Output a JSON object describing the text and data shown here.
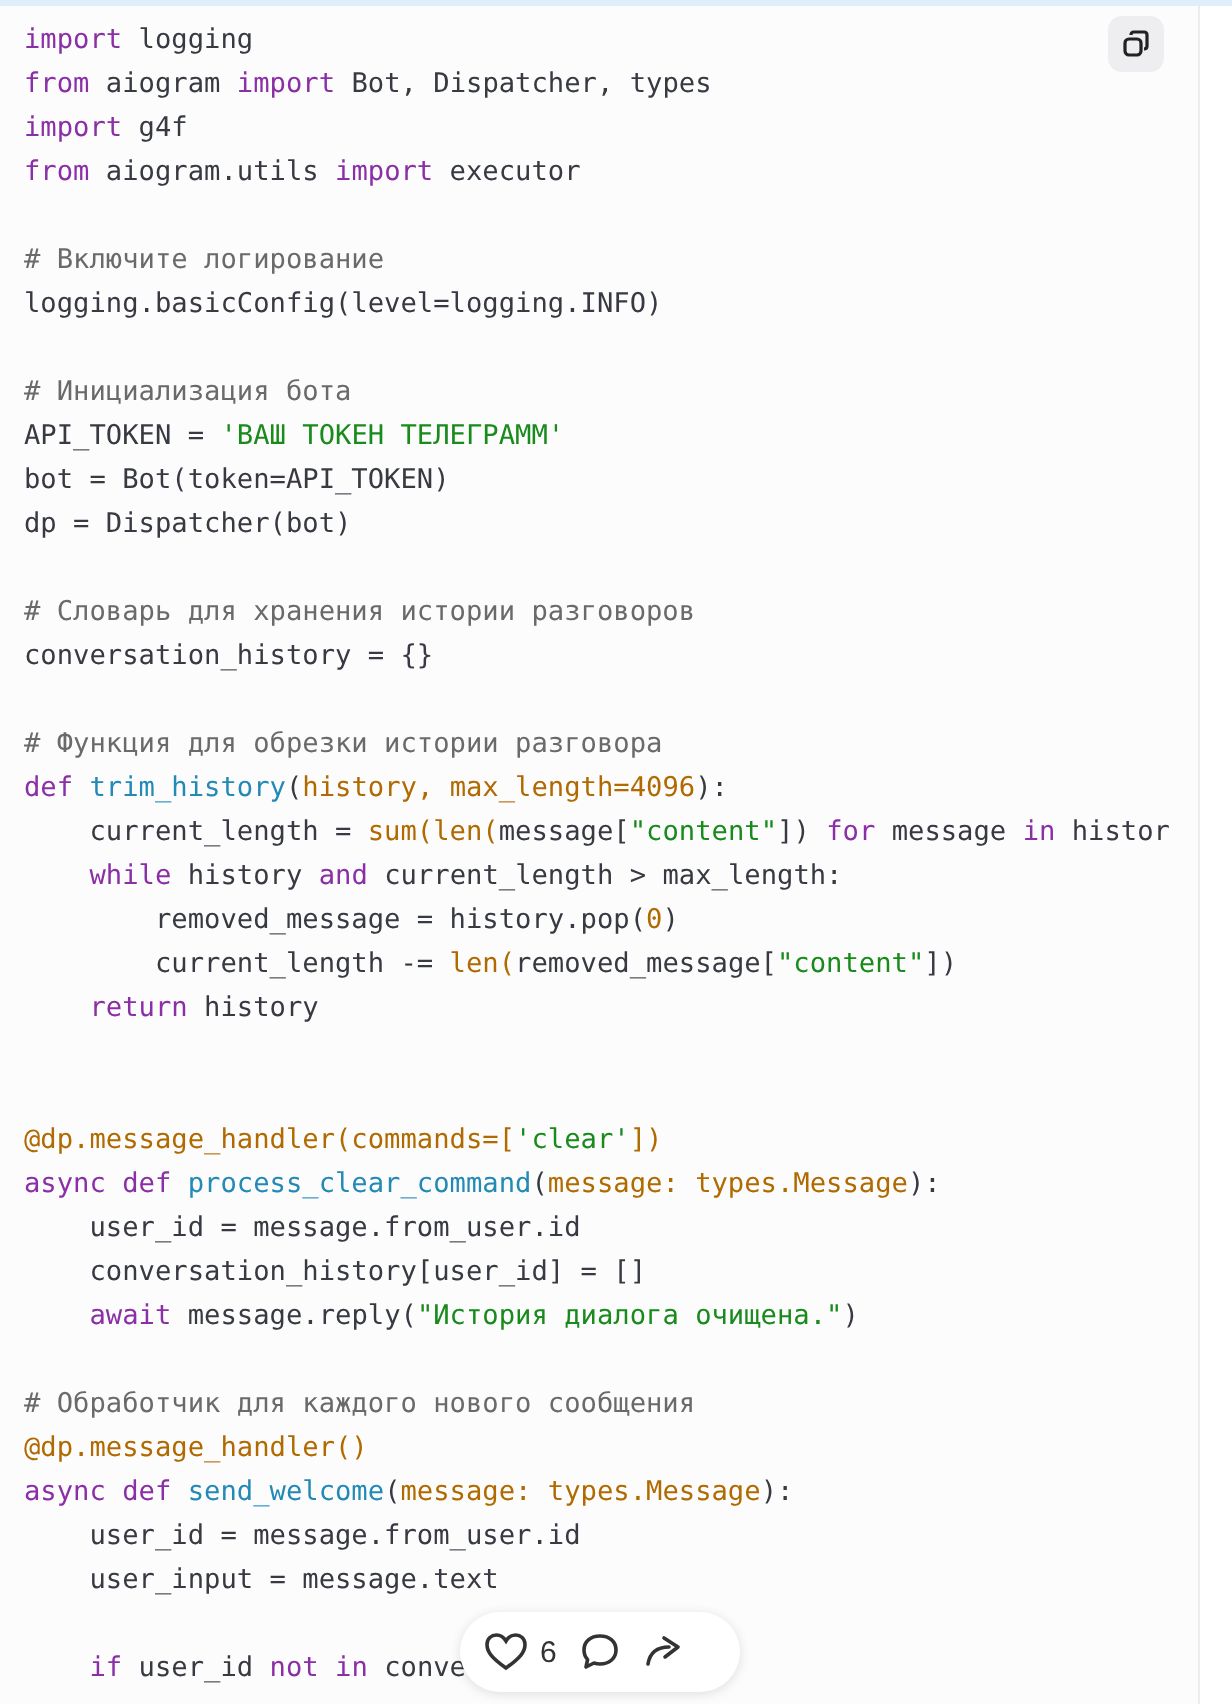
{
  "code_block": {
    "lines": [
      {
        "kind": "code",
        "tokens": [
          {
            "kind": "keyword",
            "text": "import"
          },
          " logging"
        ]
      },
      {
        "kind": "code",
        "tokens": [
          {
            "kind": "keyword",
            "text": "from"
          },
          " aiogram ",
          {
            "kind": "keyword",
            "text": "import"
          },
          " Bot, Dispatcher, types"
        ]
      },
      {
        "kind": "code",
        "tokens": [
          {
            "kind": "keyword",
            "text": "import"
          },
          " g4f"
        ]
      },
      {
        "kind": "code",
        "tokens": [
          {
            "kind": "keyword",
            "text": "from"
          },
          " aiogram.utils ",
          {
            "kind": "keyword",
            "text": "import"
          },
          " executor"
        ]
      },
      {
        "kind": "blank"
      },
      {
        "kind": "code",
        "tokens": [
          {
            "kind": "comment",
            "text": "# Включите логирование"
          }
        ]
      },
      {
        "kind": "code",
        "tokens": [
          "logging.basicConfig(level=logging.INFO)"
        ]
      },
      {
        "kind": "blank"
      },
      {
        "kind": "code",
        "tokens": [
          {
            "kind": "comment",
            "text": "# Инициализация бота"
          }
        ]
      },
      {
        "kind": "code",
        "tokens": [
          "API_TOKEN = ",
          {
            "kind": "string",
            "text": "'ВАШ ТОКЕН ТЕЛЕГРАММ'"
          }
        ]
      },
      {
        "kind": "code",
        "tokens": [
          "bot = Bot(token=API_TOKEN)"
        ]
      },
      {
        "kind": "code",
        "tokens": [
          "dp = Dispatcher(bot)"
        ]
      },
      {
        "kind": "blank"
      },
      {
        "kind": "code",
        "tokens": [
          {
            "kind": "comment",
            "text": "# Словарь для хранения истории разговоров"
          }
        ]
      },
      {
        "kind": "code",
        "tokens": [
          "conversation_history = {}"
        ]
      },
      {
        "kind": "blank"
      },
      {
        "kind": "code",
        "tokens": [
          {
            "kind": "comment",
            "text": "# Функция для обрезки истории разговора"
          }
        ]
      },
      {
        "kind": "code",
        "tokens": [
          {
            "kind": "keyword",
            "text": "def "
          },
          {
            "kind": "function",
            "text": "trim_history"
          },
          "(",
          {
            "kind": "param",
            "text": "history, max_length=4096"
          },
          "):"
        ]
      },
      {
        "kind": "code",
        "tokens": [
          "    current_length = ",
          {
            "kind": "param",
            "text": "sum(len("
          },
          "message[",
          {
            "kind": "string",
            "text": "\"content\""
          },
          "]) ",
          {
            "kind": "keyword",
            "text": "for"
          },
          " message ",
          {
            "kind": "keyword",
            "text": "in"
          },
          " histor"
        ]
      },
      {
        "kind": "code",
        "tokens": [
          {
            "kind": "keyword",
            "text": "    while"
          },
          " history ",
          {
            "kind": "keyword",
            "text": "and"
          },
          " current_length > max_length:"
        ]
      },
      {
        "kind": "code",
        "tokens": [
          "        removed_message = history.pop(",
          {
            "kind": "param",
            "text": "0"
          },
          ")"
        ]
      },
      {
        "kind": "code",
        "tokens": [
          "        current_length -= ",
          {
            "kind": "param",
            "text": "len("
          },
          "removed_message[",
          {
            "kind": "string",
            "text": "\"content\""
          },
          "])"
        ]
      },
      {
        "kind": "code",
        "tokens": [
          {
            "kind": "keyword",
            "text": "    return"
          },
          " history"
        ]
      },
      {
        "kind": "blank"
      },
      {
        "kind": "blank"
      },
      {
        "kind": "code",
        "tokens": [
          {
            "kind": "param",
            "text": "@dp.message_handler(commands=["
          },
          {
            "kind": "string",
            "text": "'clear'"
          },
          {
            "kind": "param",
            "text": "])"
          }
        ]
      },
      {
        "kind": "code",
        "tokens": [
          {
            "kind": "keyword",
            "text": "async def "
          },
          {
            "kind": "function",
            "text": "process_clear_command"
          },
          "(",
          {
            "kind": "param",
            "text": "message: types.Message"
          },
          "):"
        ]
      },
      {
        "kind": "code",
        "tokens": [
          "    user_id = message.from_user.id"
        ]
      },
      {
        "kind": "code",
        "tokens": [
          "    conversation_history[user_id] = []"
        ]
      },
      {
        "kind": "code",
        "tokens": [
          {
            "kind": "keyword",
            "text": "    await"
          },
          " message.reply(",
          {
            "kind": "string",
            "text": "\"История диалога очищена.\""
          },
          ")"
        ]
      },
      {
        "kind": "blank"
      },
      {
        "kind": "code",
        "tokens": [
          {
            "kind": "comment",
            "text": "# Обработчик для каждого нового сообщения"
          }
        ]
      },
      {
        "kind": "code",
        "tokens": [
          {
            "kind": "param",
            "text": "@dp.message_handler()"
          }
        ]
      },
      {
        "kind": "code",
        "tokens": [
          {
            "kind": "keyword",
            "text": "async def "
          },
          {
            "kind": "function",
            "text": "send_welcome"
          },
          "(",
          {
            "kind": "param",
            "text": "message: types.Message"
          },
          "):"
        ]
      },
      {
        "kind": "code",
        "tokens": [
          "    user_id = message.from_user.id"
        ]
      },
      {
        "kind": "code",
        "tokens": [
          "    user_input = message.text"
        ]
      },
      {
        "kind": "blank"
      },
      {
        "kind": "code",
        "tokens": [
          {
            "kind": "keyword",
            "text": "    if"
          },
          " user_id ",
          {
            "kind": "keyword",
            "text": "not in"
          },
          " conve"
        ]
      }
    ]
  },
  "reactions": {
    "likes": "6"
  }
}
